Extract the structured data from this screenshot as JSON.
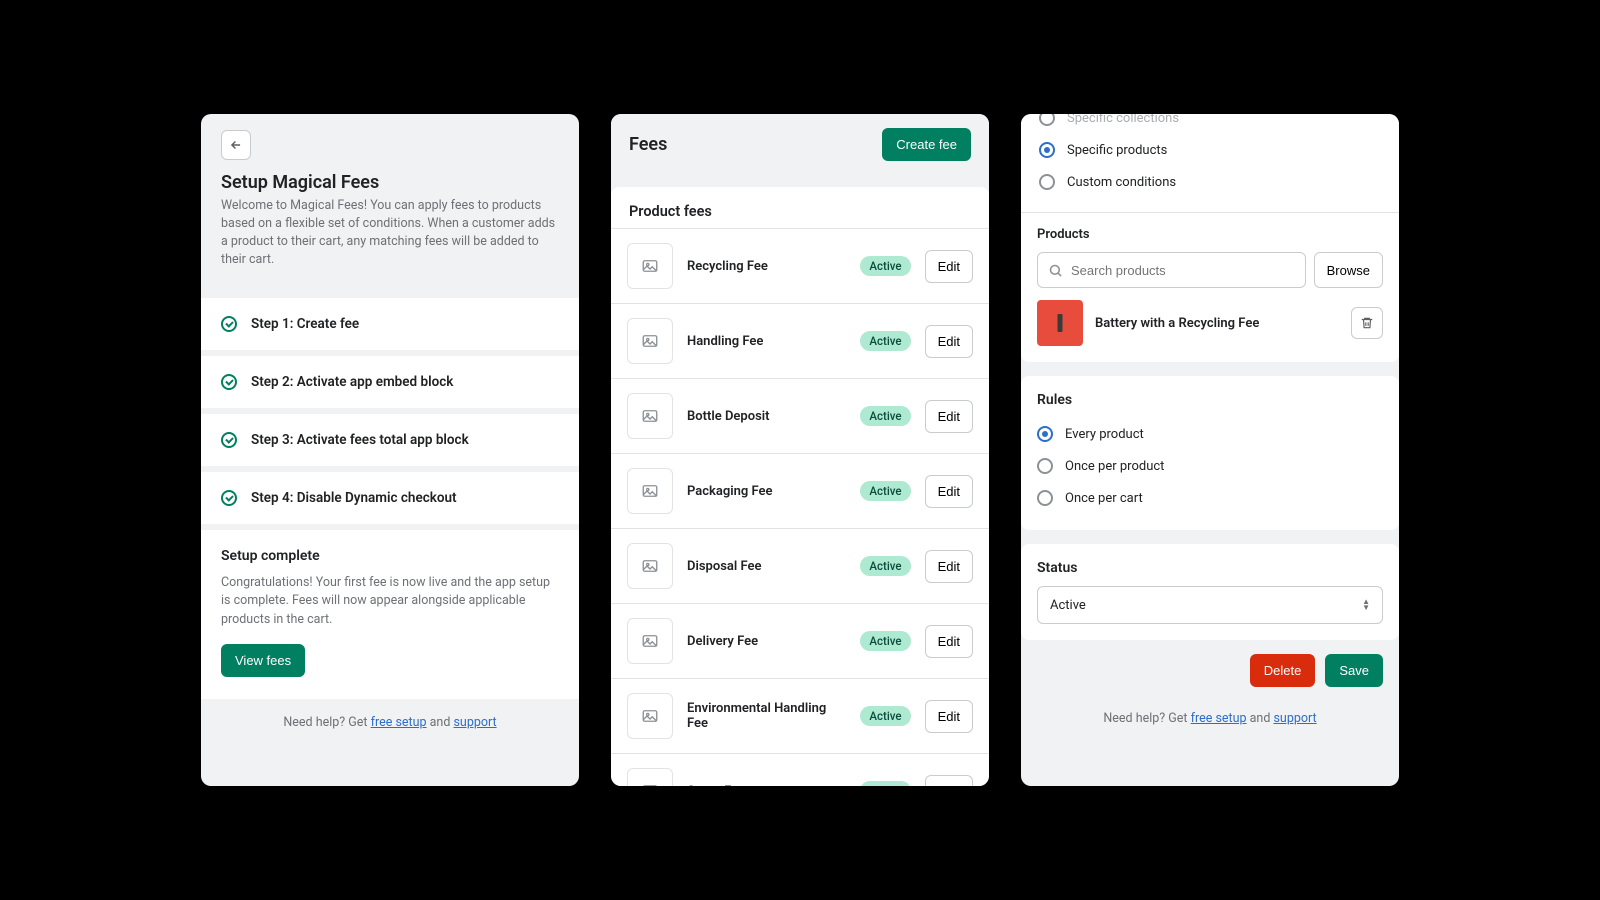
{
  "panel_a": {
    "title": "Setup Magical Fees",
    "description": "Welcome to Magical Fees! You can apply fees to products based on a flexible set of conditions. When a customer adds a product to their cart, any matching fees will be added to their cart.",
    "steps": [
      "Step 1: Create fee",
      "Step 2: Activate app embed block",
      "Step 3: Activate fees total app block",
      "Step 4: Disable Dynamic checkout"
    ],
    "complete_title": "Setup complete",
    "complete_body": "Congratulations! Your first fee is now live and the app setup is complete. Fees will now appear alongside applicable products in the cart.",
    "view_fees": "View fees",
    "help_prefix": "Need help? Get ",
    "free_setup": "free setup",
    "help_and": " and ",
    "support": "support"
  },
  "panel_b": {
    "title": "Fees",
    "create": "Create fee",
    "section_title": "Product fees",
    "active_label": "Active",
    "edit_label": "Edit",
    "fees": [
      "Recycling Fee",
      "Handling Fee",
      "Bottle Deposit",
      "Packaging Fee",
      "Disposal Fee",
      "Delivery Fee",
      "Environmental Handling Fee",
      "Setup Fee"
    ]
  },
  "panel_c": {
    "scope": {
      "collections": "Specific collections",
      "products": "Specific products",
      "custom": "Custom conditions"
    },
    "products_label": "Products",
    "search_placeholder": "Search products",
    "browse": "Browse",
    "product_name": "Battery with a Recycling Fee",
    "rules_title": "Rules",
    "rules": {
      "every": "Every product",
      "once_product": "Once per product",
      "once_cart": "Once per cart"
    },
    "status_title": "Status",
    "status_value": "Active",
    "delete": "Delete",
    "save": "Save",
    "help_prefix": "Need help? Get ",
    "free_setup": "free setup",
    "help_and": " and ",
    "support": "support"
  }
}
